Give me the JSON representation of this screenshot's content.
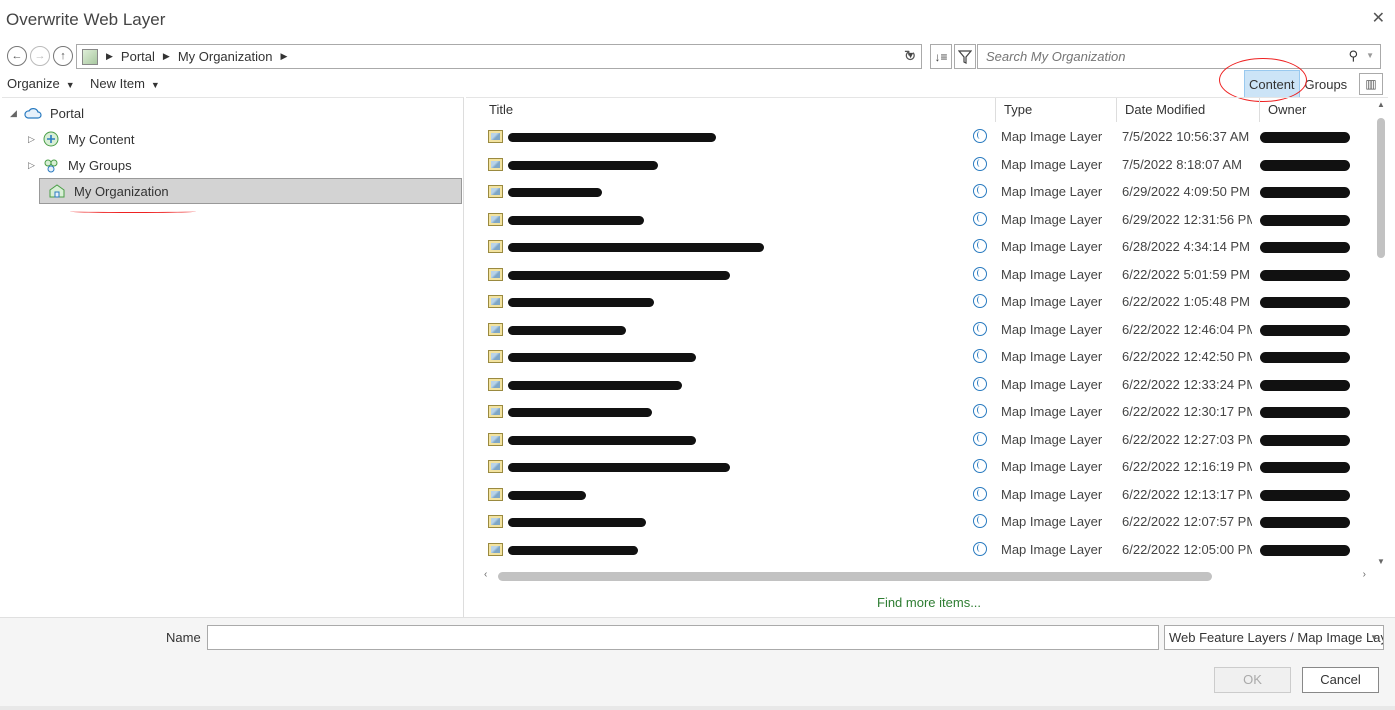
{
  "window": {
    "title": "Overwrite Web Layer"
  },
  "breadcrumb": {
    "items": [
      "Portal",
      "My Organization"
    ]
  },
  "search": {
    "placeholder": "Search My Organization"
  },
  "toolbar": {
    "organize_label": "Organize",
    "new_item_label": "New Item"
  },
  "view_tabs": {
    "content_label": "Content",
    "groups_label": "Groups",
    "active": "Content"
  },
  "tree": {
    "root": "Portal",
    "items": [
      {
        "label": "My Content",
        "icon": "my-content-icon"
      },
      {
        "label": "My Groups",
        "icon": "my-groups-icon"
      },
      {
        "label": "My Organization",
        "icon": "my-organization-icon",
        "selected": true
      }
    ]
  },
  "table": {
    "columns": [
      "Title",
      "Type",
      "Date Modified",
      "Owner"
    ],
    "rows": [
      {
        "type": "Map Image Layer",
        "date": "7/5/2022 10:56:37 AM"
      },
      {
        "type": "Map Image Layer",
        "date": "7/5/2022 8:18:07 AM"
      },
      {
        "type": "Map Image Layer",
        "date": "6/29/2022 4:09:50 PM"
      },
      {
        "type": "Map Image Layer",
        "date": "6/29/2022 12:31:56 PM"
      },
      {
        "type": "Map Image Layer",
        "date": "6/28/2022 4:34:14 PM"
      },
      {
        "type": "Map Image Layer",
        "date": "6/22/2022 5:01:59 PM"
      },
      {
        "type": "Map Image Layer",
        "date": "6/22/2022 1:05:48 PM"
      },
      {
        "type": "Map Image Layer",
        "date": "6/22/2022 12:46:04 PM"
      },
      {
        "type": "Map Image Layer",
        "date": "6/22/2022 12:42:50 PM"
      },
      {
        "type": "Map Image Layer",
        "date": "6/22/2022 12:33:24 PM"
      },
      {
        "type": "Map Image Layer",
        "date": "6/22/2022 12:30:17 PM"
      },
      {
        "type": "Map Image Layer",
        "date": "6/22/2022 12:27:03 PM"
      },
      {
        "type": "Map Image Layer",
        "date": "6/22/2022 12:16:19 PM"
      },
      {
        "type": "Map Image Layer",
        "date": "6/22/2022 12:13:17 PM"
      },
      {
        "type": "Map Image Layer",
        "date": "6/22/2022 12:07:57 PM"
      },
      {
        "type": "Map Image Layer",
        "date": "6/22/2022 12:05:00 PM"
      }
    ]
  },
  "find_more_label": "Find more items...",
  "footer": {
    "name_label": "Name",
    "name_value": "",
    "type_filter": "Web Feature Layers / Map Image Layers",
    "ok_label": "OK",
    "cancel_label": "Cancel"
  },
  "colors": {
    "accent_tab": "#cce4f7",
    "annotation_red": "#e22222",
    "link_green": "#2e7d32"
  }
}
